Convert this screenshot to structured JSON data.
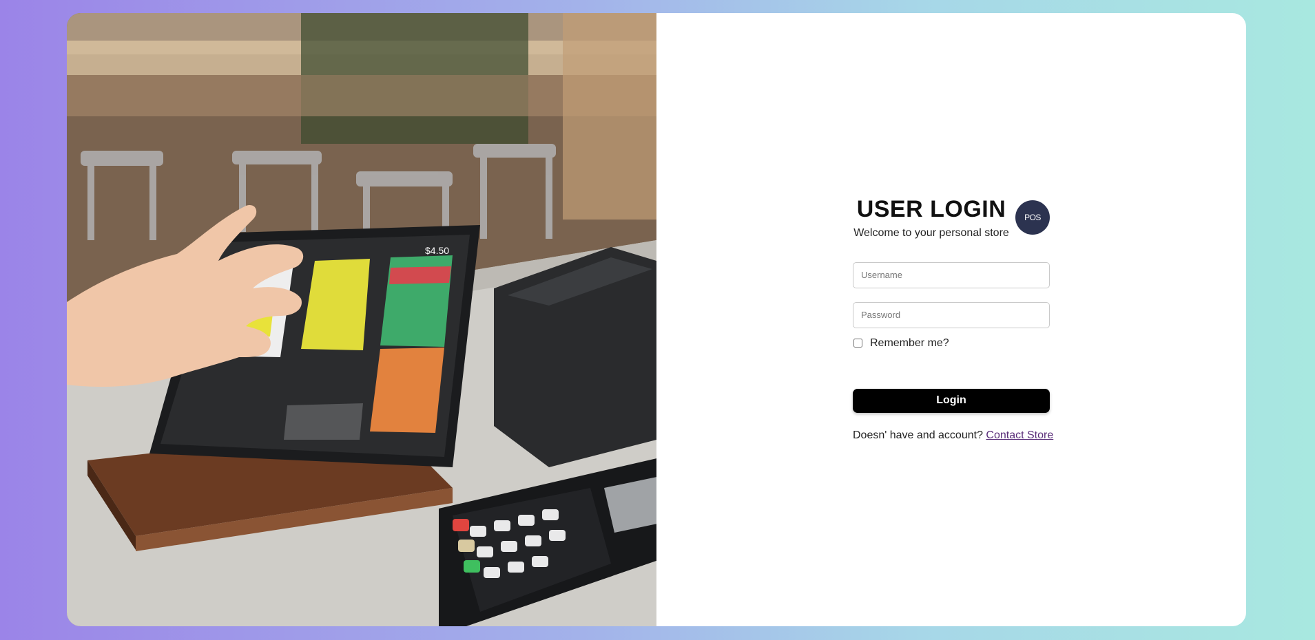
{
  "login": {
    "title": "USER LOGIN",
    "subtitle": "Welcome to your personal store",
    "logo_text": "POS",
    "username_placeholder": "Username",
    "password_placeholder": "Password",
    "remember_label": "Remember me?",
    "login_label": "Login",
    "signup_prompt": "Doesn' have and account?",
    "signup_link": "Contact Store"
  },
  "terminal": {
    "total": "$4.50"
  },
  "colors": {
    "accent": "#000000",
    "logo_bg": "#2c3350",
    "link": "#5b2f7a"
  }
}
